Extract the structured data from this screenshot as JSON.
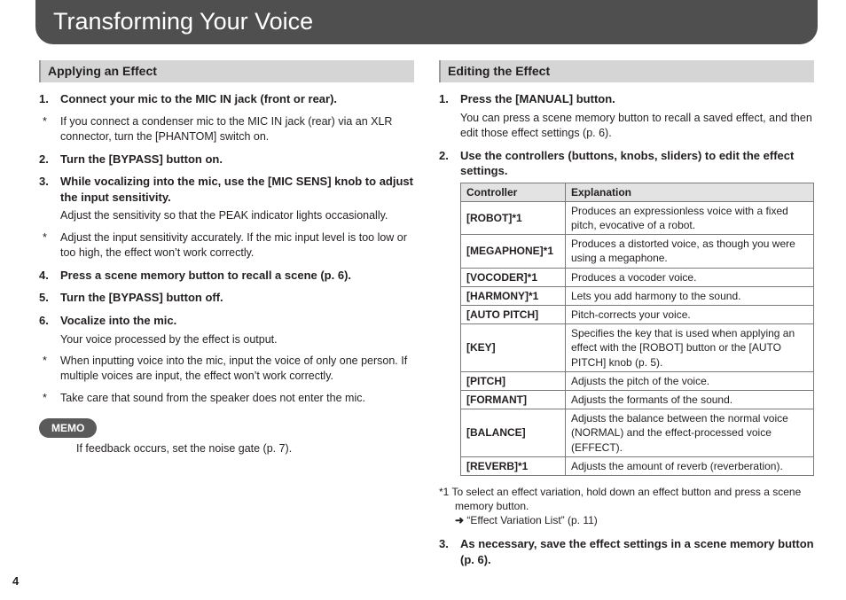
{
  "pageNumber": "4",
  "title": "Transforming Your Voice",
  "left": {
    "heading": "Applying an Effect",
    "steps": [
      {
        "head": "Connect your mic to the MIC IN jack (front or rear).",
        "notes_after": [
          "If you connect a condenser mic to the MIC IN jack (rear) via an XLR connector, turn the [PHANTOM] switch on."
        ]
      },
      {
        "head": "Turn the [BYPASS] button on."
      },
      {
        "head": "While vocalizing into the mic, use the [MIC SENS] knob to adjust the input sensitivity.",
        "body": "Adjust the sensitivity so that the PEAK indicator lights occasionally.",
        "notes_after": [
          "Adjust the input sensitivity accurately. If the mic input level is too low or too high, the effect won’t work correctly."
        ]
      },
      {
        "head": "Press a scene memory button to recall a scene (p. 6)."
      },
      {
        "head": "Turn the [BYPASS] button off."
      },
      {
        "head": "Vocalize into the mic.",
        "body": "Your voice processed by the effect is output.",
        "notes_after": [
          "When inputting voice into the mic, input the voice of only one person. If multiple voices are input, the effect won’t work correctly.",
          "Take care that sound from the speaker does not enter the mic."
        ]
      }
    ],
    "memoLabel": "MEMO",
    "memoText": "If feedback occurs, set the noise gate (p. 7)."
  },
  "right": {
    "heading": "Editing the Effect",
    "step1": {
      "head": "Press the [MANUAL] button.",
      "body": "You can press a scene memory button to recall a saved effect, and then edit those effect settings (p. 6)."
    },
    "step2_head": "Use the controllers (buttons, knobs, sliders) to edit the effect settings.",
    "table": {
      "headers": [
        "Controller",
        "Explanation"
      ],
      "rows": [
        [
          "[ROBOT]*1",
          "Produces an expressionless voice with a fixed pitch, evocative of a robot."
        ],
        [
          "[MEGAPHONE]*1",
          "Produces a distorted voice, as though you were using a megaphone."
        ],
        [
          "[VOCODER]*1",
          "Produces a vocoder voice."
        ],
        [
          "[HARMONY]*1",
          "Lets you add harmony to the sound."
        ],
        [
          "[AUTO PITCH]",
          "Pitch-corrects your voice."
        ],
        [
          "[KEY]",
          "Specifies the key that is used when applying an effect with the [ROBOT] button or the [AUTO PITCH] knob (p. 5)."
        ],
        [
          "[PITCH]",
          "Adjusts the pitch of the voice."
        ],
        [
          "[FORMANT]",
          "Adjusts the formants of the sound."
        ],
        [
          "[BALANCE]",
          "Adjusts the balance between the normal voice (NORMAL) and the effect-processed voice (EFFECT)."
        ],
        [
          "[REVERB]*1",
          "Adjusts the amount of reverb (reverberation)."
        ]
      ]
    },
    "footnote": "*1 To select an effect variation, hold down an effect button and press a scene memory button.",
    "ref_arrow": "➜",
    "ref_text": "“Effect Variation List” (p. 11)",
    "step3_head": "As necessary, save the effect settings in a scene memory button (p. 6)."
  }
}
